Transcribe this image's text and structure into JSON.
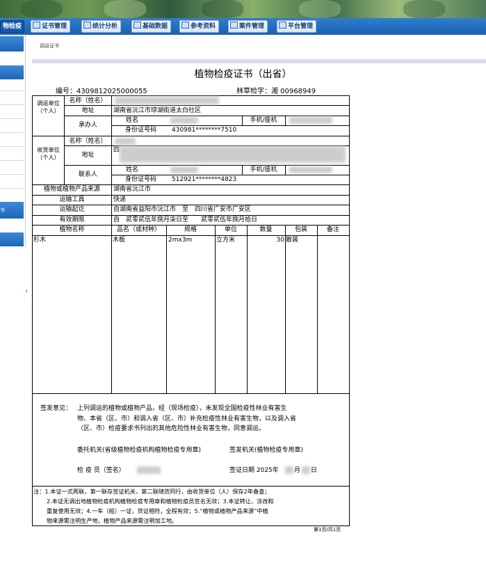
{
  "nav": {
    "current": "物检疫",
    "items": [
      "证书管理",
      "统计分析",
      "基础数据",
      "参考资料",
      "案件管理",
      "平台管理"
    ]
  },
  "sidebar": {
    "label": "书"
  },
  "breadcrumb": "调运证书",
  "certificate": {
    "title": "植物检疫证书（出省）",
    "number_label": "编号：",
    "number": "4309812025000055",
    "forest_label": "林草检字：",
    "forest_value": "湘 00968949",
    "shipper": {
      "group_label": "调运单位（个人）",
      "name_label": "名称（姓名）",
      "address_label": "地址",
      "address": "湖南省沅江市琼湖街道太白社区",
      "handler_label": "承办人",
      "person_name_label": "姓名",
      "phone_label": "手机/座机",
      "id_label": "身份证号码",
      "id": "430981********7510"
    },
    "receiver": {
      "group_label": "收货单位（个人）",
      "name_label": "名称（姓名）",
      "address_label": "地址",
      "address_prefix": "四",
      "contact_label": "联系人",
      "person_name_label": "姓名",
      "phone_label": "手机/座机",
      "id_label": "身份证号码",
      "id": "512921********4823"
    },
    "source_label": "植物或植物产品来源",
    "source": "湖南省沅江市",
    "transport_label": "运输工具",
    "transport": "快递",
    "route_label": "运输起讫",
    "route": "自湖南省益阳市沅江市　至　四川省广安市广安区",
    "valid_label": "有效期限",
    "valid": "自　贰零贰伍年捌月柒日至　　贰零贰伍年捌月拾日",
    "columns": [
      "植物名称",
      "品名（或材种）",
      "规格",
      "单位",
      "数量",
      "包装",
      "备注"
    ],
    "rows": [
      {
        "plant": "杉木",
        "product": "木板",
        "spec": "2mx3m",
        "unit": "立方米",
        "qty": "30",
        "pack": "散装",
        "note": ""
      }
    ],
    "opinion_label": "签发意见：",
    "opinion_lines": [
      "上列调运的植物或植物产品，经（现场检疫），未发现全国检疫性林业有害生",
      "物、本省（区、市）和调入省（区、市）补充检疫性林业有害生物，以及调入省",
      "（区、市）检疫要求书列出的其他危险性林业有害生物，同意调运。"
    ],
    "seal_left": "委托机关(省级植物检疫机构植物检疫专用章)",
    "seal_right": "签发机关(植物检疫专用章)",
    "inspector_label": "检 疫 员（签名）",
    "sign_date_label": "签证日期 2025年",
    "month_char": "月",
    "day_char": "日",
    "notes": [
      "注：1.本证一式两联，第一联存签证机关，第二联随货同行，由收货单位（人）保存2年备查；",
      "2.本证无调出地植物检疫机构植物检疫专用章和植物检疫员签名无效；3.本证转让、涂改和",
      "重复使用无效；4.一车（船）一证，货证相符，全程有效；5.“植物或植物产品来源”中植",
      "物来源需注明生产地，植物产品来源需注明加工地。"
    ],
    "pager": "第1页/共1页"
  }
}
